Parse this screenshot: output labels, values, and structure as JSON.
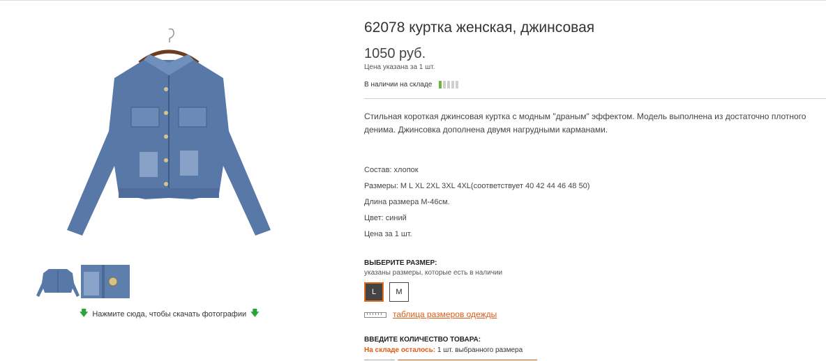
{
  "product": {
    "title": "62078 куртка женская, джинсовая",
    "price": "1050 руб.",
    "price_note": "Цена указана за 1 шт.",
    "stock_label": "В наличии на складе",
    "stock_level": 1,
    "stock_scale": 5,
    "description": "Стильная короткая джинсовая куртка с модным  \"драным\" эффектом. Модель выполнена из достаточно плотного денима. Джинсовка дополнена двумя нагрудными карманами.",
    "specs": [
      "Состав: хлопок",
      "Размеры:  M L XL 2XL 3XL 4XL(соответствует 40 42 44 46 48 50)",
      "Длина размера M-46см.",
      "Цвет: синий",
      "Цена за 1 шт."
    ]
  },
  "gallery": {
    "download_text": "Нажмите сюда, чтобы скачать фотографии"
  },
  "size_picker": {
    "heading": "ВЫБЕРИТЕ РАЗМЕР:",
    "subtext": "указаны размеры, которые есть в наличии",
    "options": [
      "L",
      "M"
    ],
    "selected": "L",
    "table_link": "таблица размеров одежды"
  },
  "quantity": {
    "heading": "ВВЕДИТЕ КОЛИЧЕСТВО ТОВАРА:",
    "stock_left_label": "На складе осталось:",
    "stock_left_value": "1 шт. выбранного размера"
  },
  "colors": {
    "accent": "#e05a14",
    "stock_on": "#6cb33f",
    "denim": "#5e7fac"
  }
}
